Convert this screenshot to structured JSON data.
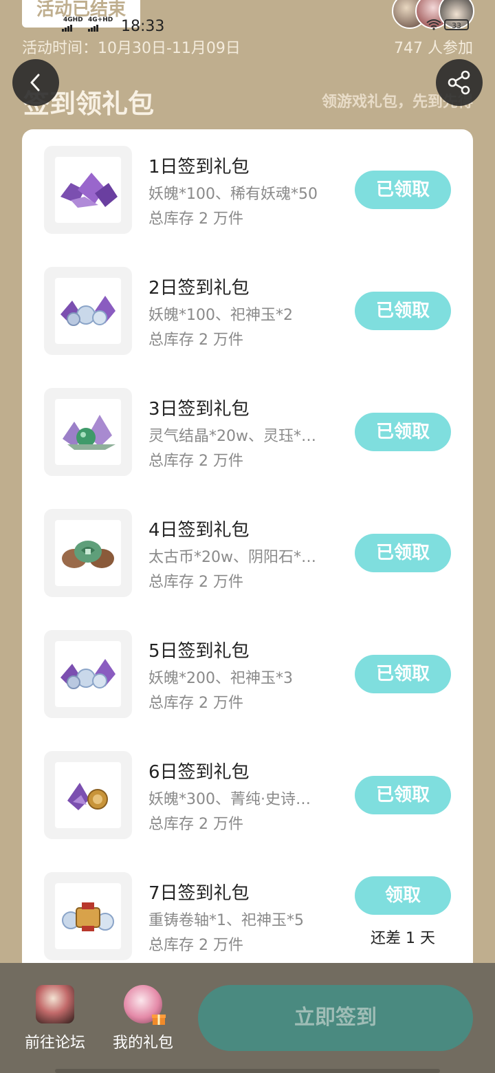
{
  "status_bar": {
    "ended_tag": "活动已结束",
    "net1": "4GHD",
    "net2": "4G+HD",
    "time": "18:33",
    "battery": "33"
  },
  "header": {
    "activity_time": "活动时间：10月30日-11月09日",
    "participants": "747 人参加",
    "title": "签到领礼包",
    "subtitle": "领游戏礼包，先到先得"
  },
  "gifts": [
    {
      "title": "1日签到礼包",
      "desc": "妖魄*100、稀有妖魂*50",
      "stock": "总库存 2 万件",
      "button": "已领取",
      "icon": "purple-crystals-icon"
    },
    {
      "title": "2日签到礼包",
      "desc": "妖魄*100、祀神玉*2",
      "stock": "总库存 2 万件",
      "button": "已领取",
      "icon": "crystals-orbs-icon"
    },
    {
      "title": "3日签到礼包",
      "desc": "灵气结晶*20w、灵珏*…",
      "stock": "总库存 2 万件",
      "button": "已领取",
      "icon": "green-crystals-icon"
    },
    {
      "title": "4日签到礼包",
      "desc": "太古币*20w、阴阳石*…",
      "stock": "总库存 2 万件",
      "button": "已领取",
      "icon": "coins-icon"
    },
    {
      "title": "5日签到礼包",
      "desc": "妖魄*200、祀神玉*3",
      "stock": "总库存 2 万件",
      "button": "已领取",
      "icon": "crystals-orbs-icon"
    },
    {
      "title": "6日签到礼包",
      "desc": "妖魄*300、菁纯·史诗…",
      "stock": "总库存 2 万件",
      "button": "已领取",
      "icon": "crystal-medal-icon"
    },
    {
      "title": "7日签到礼包",
      "desc": "重铸卷轴*1、祀神玉*5",
      "stock": "总库存 2 万件",
      "button": "领取",
      "note": "还差 1 天",
      "icon": "scroll-orbs-icon"
    }
  ],
  "bottom": {
    "forum_label": "前往论坛",
    "gifts_label": "我的礼包",
    "sign_button": "立即签到"
  },
  "colors": {
    "background": "#bfae8e",
    "claim_button": "#7fdede",
    "sign_button": "#4a8a80",
    "bottom_bar": "#726c60"
  }
}
